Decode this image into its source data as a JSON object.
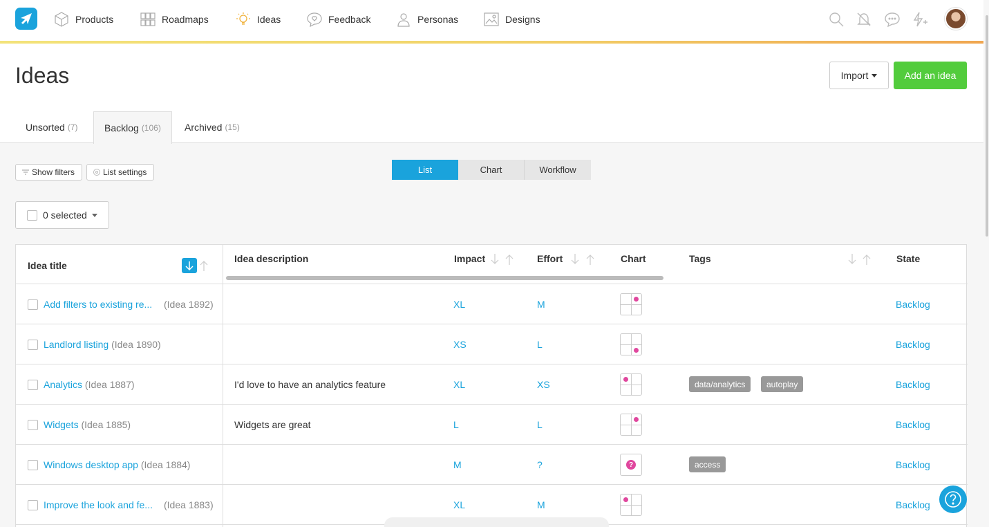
{
  "nav": {
    "items": [
      {
        "label": "Products",
        "icon": "cube-icon"
      },
      {
        "label": "Roadmaps",
        "icon": "grid-icon"
      },
      {
        "label": "Ideas",
        "icon": "lightbulb-icon"
      },
      {
        "label": "Feedback",
        "icon": "heart-bubble-icon"
      },
      {
        "label": "Personas",
        "icon": "person-icon"
      },
      {
        "label": "Designs",
        "icon": "image-icon"
      }
    ],
    "right_icons": [
      "search-icon",
      "bell-off-icon",
      "chat-icon",
      "lightning-plus-icon",
      "avatar"
    ]
  },
  "page": {
    "title": "Ideas",
    "import_label": "Import",
    "add_label": "Add an idea"
  },
  "tabs": [
    {
      "label": "Unsorted",
      "count": "(7)"
    },
    {
      "label": "Backlog",
      "count": "(106)"
    },
    {
      "label": "Archived",
      "count": "(15)"
    }
  ],
  "toolbar": {
    "show_filters": "Show filters",
    "list_settings": "List settings",
    "views": [
      "List",
      "Chart",
      "Workflow"
    ],
    "selected": "0 selected"
  },
  "table": {
    "columns": [
      "Idea title",
      "Idea description",
      "Impact",
      "Effort",
      "Chart",
      "Tags",
      "State"
    ],
    "rows": [
      {
        "title": "Add filters to existing re...",
        "ref": "(Idea 1892)",
        "description": "",
        "impact": "XL",
        "effort": "M",
        "tags": [],
        "state": "Backlog",
        "chart": "top-right"
      },
      {
        "title": "Landlord listing",
        "ref": "(Idea 1890)",
        "description": "",
        "impact": "XS",
        "effort": "L",
        "tags": [],
        "state": "Backlog",
        "chart": "bottom-right"
      },
      {
        "title": "Analytics",
        "ref": "(Idea 1887)",
        "description": "I'd love to have an analytics feature",
        "impact": "XL",
        "effort": "XS",
        "tags": [
          "data/analytics",
          "autoplay"
        ],
        "state": "Backlog",
        "chart": "top-left"
      },
      {
        "title": "Widgets",
        "ref": "(Idea 1885)",
        "description": "Widgets are great",
        "impact": "L",
        "effort": "L",
        "tags": [],
        "state": "Backlog",
        "chart": "top-right"
      },
      {
        "title": "Windows desktop app",
        "ref": "(Idea 1884)",
        "description": "",
        "impact": "M",
        "effort": "?",
        "tags": [
          "access"
        ],
        "state": "Backlog",
        "chart": "unknown"
      },
      {
        "title": "Improve the look and fe...",
        "ref": "(Idea 1883)",
        "description": "",
        "impact": "XL",
        "effort": "M",
        "tags": [],
        "state": "Backlog",
        "chart": "top-left"
      }
    ]
  },
  "colors": {
    "accent": "#1aa3dc",
    "add_button": "#52cc3c",
    "chart_dot": "#e0479e",
    "tag_bg": "#999999"
  }
}
